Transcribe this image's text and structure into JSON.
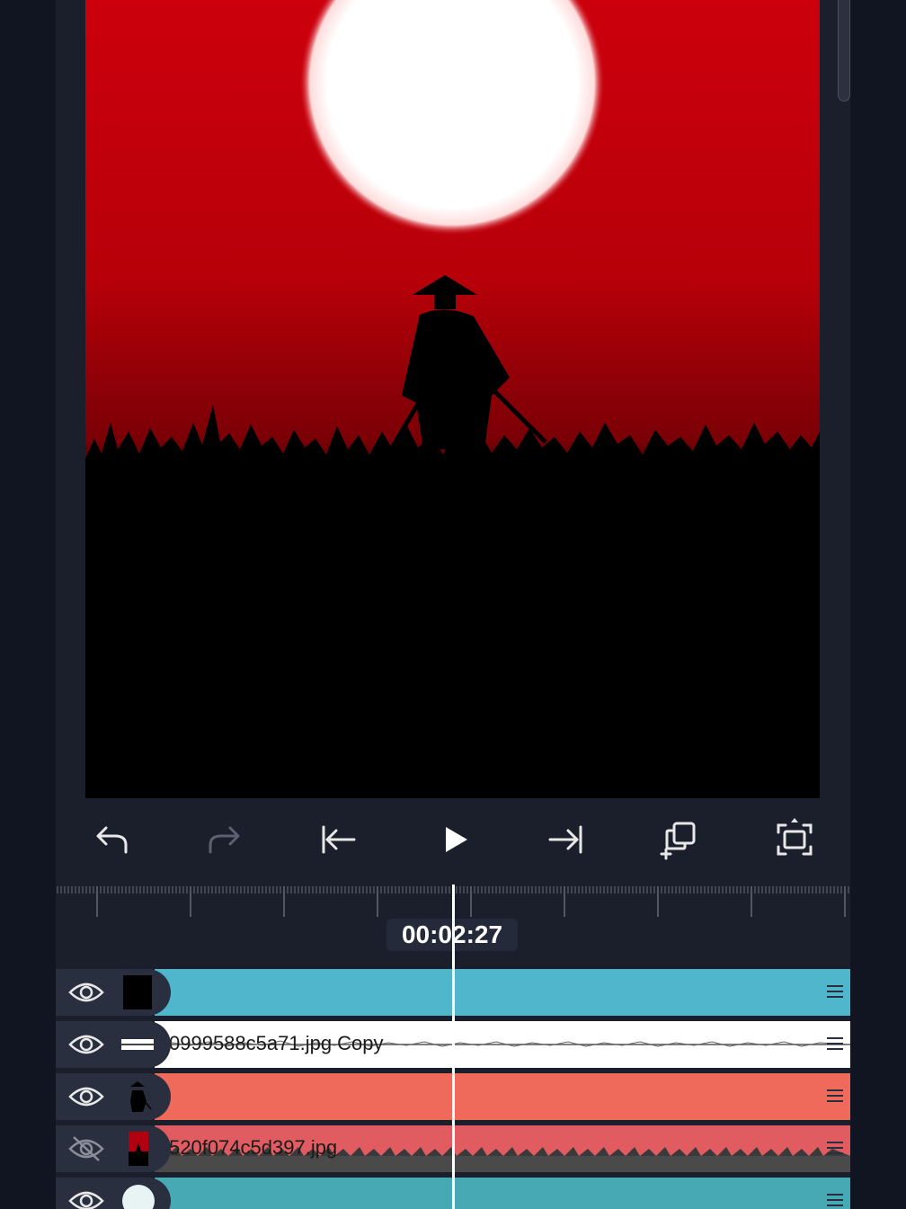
{
  "toolbar": {
    "undo": "undo-icon",
    "redo": "redo-icon",
    "jump_start": "jump-to-start-icon",
    "play": "play-icon",
    "jump_end": "jump-to-end-icon",
    "duplicate": "duplicate-icon",
    "fullscreen": "fullscreen-icon"
  },
  "timeline": {
    "timecode": "00:02:27"
  },
  "tracks": [
    {
      "visible": true,
      "label": "",
      "clip_color": "#4fb6cb",
      "thumb": "black-square"
    },
    {
      "visible": true,
      "label": "0999588c5a71.jpg Copy",
      "clip_color": "#ffffff",
      "thumb": "white-bar"
    },
    {
      "visible": true,
      "label": "",
      "clip_color": "#ef6a5a",
      "thumb": "samurai-silhouette"
    },
    {
      "visible": false,
      "label": "520f074c5d397.jpg",
      "clip_color": "#e05c60",
      "thumb": "red-scene"
    },
    {
      "visible": true,
      "label": "",
      "clip_color": "#46a9b4",
      "thumb": "white-circle"
    }
  ],
  "colors": {
    "sky_top": "#c8000c",
    "sky_bottom": "#3a0000",
    "moon": "#ffffff",
    "panel": "#1b1f2c"
  }
}
